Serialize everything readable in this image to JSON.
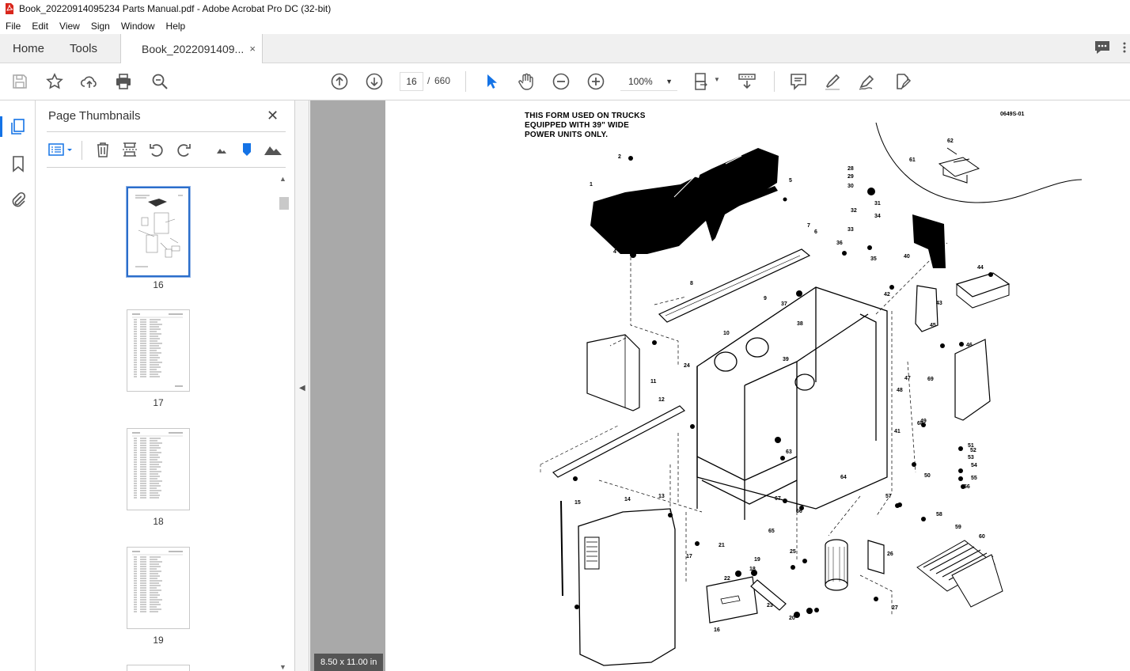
{
  "window": {
    "title": "Book_20220914095234 Parts Manual.pdf - Adobe Acrobat Pro DC (32-bit)"
  },
  "menu": [
    "File",
    "Edit",
    "View",
    "Sign",
    "Window",
    "Help"
  ],
  "tabs": {
    "home": "Home",
    "tools": "Tools",
    "document": "Book_2022091409...",
    "close_glyph": "×"
  },
  "toolbar": {
    "current_page": "16",
    "page_separator": "/",
    "total_pages": "660",
    "zoom": "100%"
  },
  "thumbnails_panel": {
    "title": "Page Thumbnails",
    "close_glyph": "✕",
    "pages": [
      {
        "label": "16",
        "selected": true
      },
      {
        "label": "17",
        "selected": false
      },
      {
        "label": "18",
        "selected": false
      },
      {
        "label": "19",
        "selected": false
      }
    ]
  },
  "document": {
    "page_size": "8.50 x 11.00 in",
    "note": [
      "THIS FORM USED ON TRUCKS",
      "EQUIPPED WITH 39\" WIDE",
      "POWER UNITS ONLY."
    ],
    "form_code": "0649S-01",
    "callouts": [
      "1",
      "2",
      "3",
      "4",
      "5",
      "6",
      "7",
      "8",
      "9",
      "10",
      "11",
      "12",
      "13",
      "14",
      "15",
      "16",
      "17",
      "18",
      "19",
      "20",
      "21",
      "22",
      "23",
      "24",
      "25",
      "26",
      "27",
      "28",
      "29",
      "30",
      "31",
      "32",
      "33",
      "34",
      "35",
      "36",
      "37",
      "38",
      "39",
      "40",
      "41",
      "42",
      "43",
      "44",
      "45",
      "46",
      "47",
      "48",
      "49",
      "50",
      "51",
      "52",
      "53",
      "54",
      "55",
      "56",
      "57",
      "58",
      "59",
      "60",
      "61",
      "62",
      "63",
      "64",
      "65",
      "66",
      "67",
      "68",
      "69"
    ]
  },
  "colors": {
    "accent": "#1473e6",
    "doc_background": "#a9a9a9",
    "tab_background": "#f0f0f0",
    "pdf_red": "#d9261c"
  }
}
